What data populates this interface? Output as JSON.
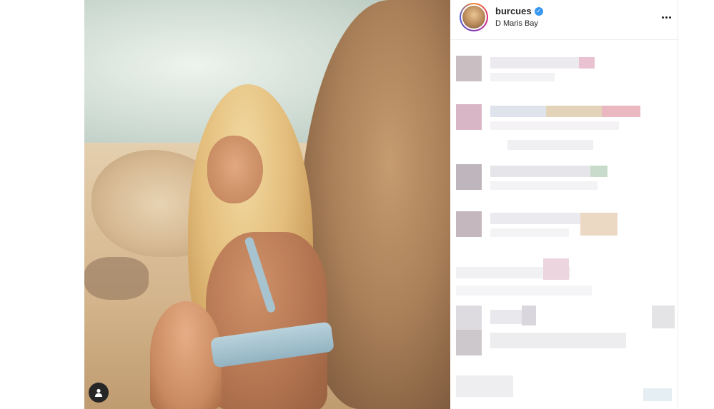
{
  "post": {
    "username": "burcues",
    "verified": true,
    "location": "D Maris Bay"
  },
  "icons": {
    "verified": "verified-badge-icon",
    "more": "more-options-icon",
    "tag": "user-tag-icon"
  },
  "colors": {
    "accent_verified": "#3897f0",
    "text": "#262626",
    "divider": "#efefef"
  }
}
